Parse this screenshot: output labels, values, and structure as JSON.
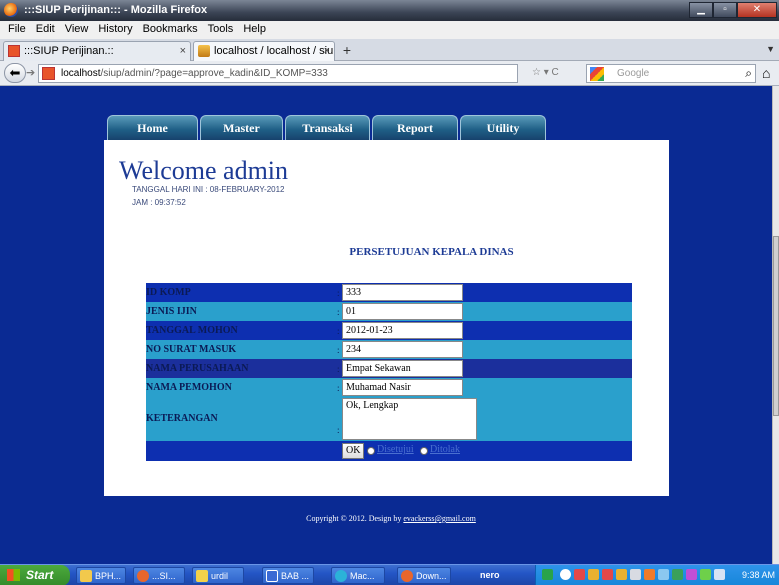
{
  "window": {
    "title": ":::SIUP Perijinan::: - Mozilla Firefox"
  },
  "menu": [
    "File",
    "Edit",
    "View",
    "History",
    "Bookmarks",
    "Tools",
    "Help"
  ],
  "tabs": [
    {
      "label": ":::SIUP Perijinan.::"
    },
    {
      "label": "localhost / localhost / siup / nomor_m..."
    }
  ],
  "nav": {
    "url_host": "localhost",
    "url_path": "/siup/admin/?page=approve_kadin&ID_KOMP=333",
    "search_placeholder": "Google"
  },
  "site": {
    "nav_tabs": [
      "Home",
      "Master",
      "Transaksi",
      "Report",
      "Utility"
    ],
    "welcome": "Welcome admin",
    "date_line": "TANGGAL HARI INI : 08-FEBRUARY-2012",
    "time_line": "JAM : 09:37:52",
    "form_title": "PERSETUJUAN KEPALA DINAS",
    "fields": [
      {
        "label": "ID KOMP",
        "colon": ":",
        "value": "333"
      },
      {
        "label": "JENIS IJIN",
        "colon": ":",
        "value": "01"
      },
      {
        "label": "TANGGAL MOHON",
        "colon": ":",
        "value": "2012-01-23"
      },
      {
        "label": "NO SURAT MASUK",
        "colon": ":",
        "value": "234"
      },
      {
        "label": "NAMA PERUSAHAAN",
        "colon": ":",
        "value": "Empat Sekawan"
      },
      {
        "label": "NAMA PEMOHON",
        "colon": ":",
        "value": "Muhamad Nasir"
      }
    ],
    "keterangan": {
      "label": "KETERANGAN",
      "colon": ":",
      "value": "Ok, Lengkap"
    },
    "ok_label": "OK",
    "option_accept": "Disetujui",
    "option_reject": "Ditolak",
    "copyright_prefix": "Copyright © 2012. Design by ",
    "copyright_email": "evackerss@gmail.com"
  },
  "taskbar": {
    "start": "Start",
    "items": [
      "BPH...",
      "...SI...",
      "urdil",
      "BAB ...",
      "Mac...",
      "Down..."
    ],
    "nero": "nero",
    "clock": "9:38 AM"
  }
}
